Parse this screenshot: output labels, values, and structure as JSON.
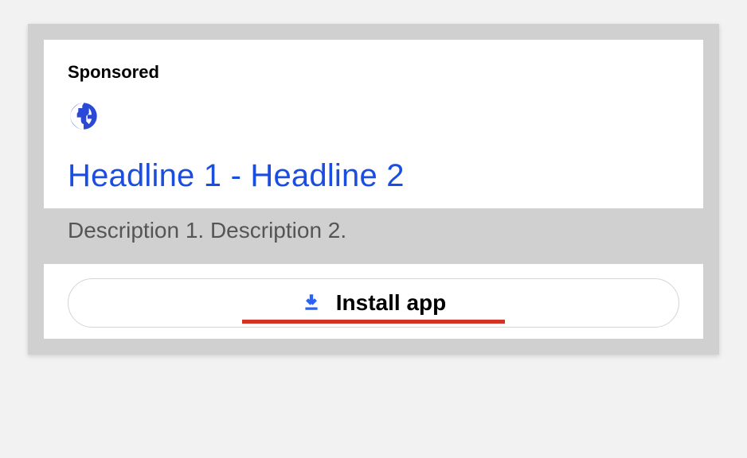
{
  "ad": {
    "sponsored_label": "Sponsored",
    "headline": "Headline 1 - Headline 2",
    "description": "Description 1. Description 2.",
    "install_label": "Install app"
  },
  "colors": {
    "link_blue": "#1a4de0",
    "download_blue": "#2a63f4",
    "underline_red": "#d43224",
    "card_border_gray": "#d0d0d0"
  }
}
